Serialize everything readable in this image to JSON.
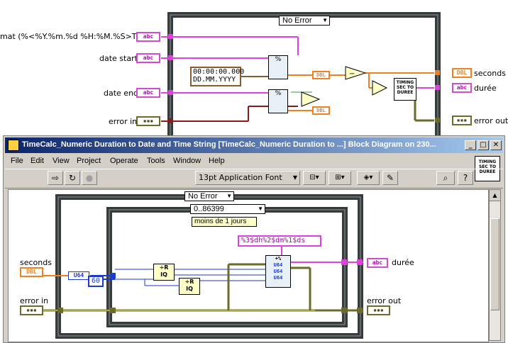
{
  "top_diagram": {
    "case_selector": "No Error",
    "inputs": {
      "format": "mat (%<%Y.%m.%d %H:%M.%S>T)",
      "date_start": "date start",
      "date_end": "date end",
      "error_in": "error in"
    },
    "outputs": {
      "seconds": "seconds",
      "duree": "durée",
      "error_out": "error out"
    },
    "constant_line1": "00:00:00.000",
    "constant_line2": "DD.MM.YYYY",
    "timing_vi": "TIMING SEC TO DUREE",
    "term_abc": "abc",
    "term_dbl": "DBL"
  },
  "window": {
    "title": "TimeCalc_Numeric Duration to Date and Time String [TimeCalc_Numeric Duration to ...] Block Diagram on 230...",
    "menu": [
      "File",
      "Edit",
      "View",
      "Project",
      "Operate",
      "Tools",
      "Window",
      "Help"
    ],
    "font_dropdown": "13pt Application Font",
    "icon_caption": "TIMING SEC TO DUREE"
  },
  "bottom_diagram": {
    "case_selector": "No Error",
    "inner_case": "0..86399",
    "inner_label": "moins de 1 jours",
    "format_string": "%3$dh%2$dm%1$ds",
    "constant_60": "60",
    "u64": "U64",
    "seconds": "seconds",
    "error_in": "error in",
    "duree": "durée",
    "error_out": "error out"
  }
}
